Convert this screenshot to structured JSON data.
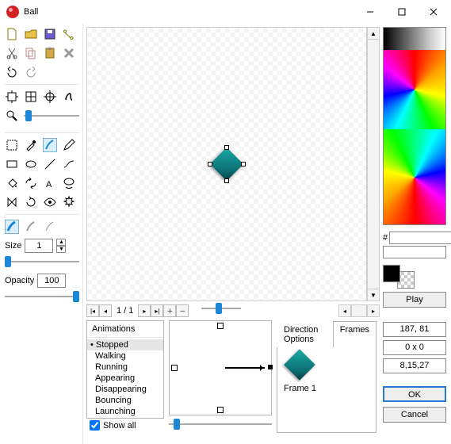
{
  "window": {
    "title": "Ball"
  },
  "toolbar": {
    "row1": [
      "new",
      "open",
      "save",
      "cut-link"
    ],
    "row2": [
      "scissors",
      "copy",
      "paste",
      "delete"
    ],
    "row3": [
      "undo",
      "redo"
    ],
    "row4": [
      "bounds",
      "grid",
      "crosshair",
      "alpha"
    ],
    "row5": [
      "zoom",
      "slider"
    ]
  },
  "tools": {
    "row1": [
      "select",
      "picker",
      "brush",
      "pencil"
    ],
    "row2": [
      "rect",
      "ellipse",
      "line",
      "curve"
    ],
    "row3": [
      "bucket",
      "wand",
      "text",
      "clone"
    ],
    "row4": [
      "flip",
      "rotate",
      "eye",
      "star"
    ]
  },
  "brush": {
    "variants": [
      "soft",
      "mid",
      "hard"
    ],
    "size_label": "Size",
    "size_value": "1",
    "opacity_label": "Opacity",
    "opacity_value": "100"
  },
  "pager": {
    "current": "1 / 1"
  },
  "animations": {
    "title": "Animations",
    "items": [
      "• Stopped",
      "   Walking",
      "   Running",
      "   Appearing",
      "   Disappearing",
      "   Bouncing",
      "   Launching"
    ],
    "selected_index": 0,
    "show_all_label": "Show all",
    "show_all_checked": true
  },
  "tabs": {
    "tab0": "Direction Options",
    "tab1": "Frames",
    "active": 1,
    "frame_label": "Frame 1"
  },
  "palette": {
    "hex_label": "#"
  },
  "right": {
    "play_label": "Play",
    "coords": "187, 81",
    "size": "0 x 0",
    "color_rgb": "8,15,27",
    "ok_label": "OK",
    "cancel_label": "Cancel"
  }
}
